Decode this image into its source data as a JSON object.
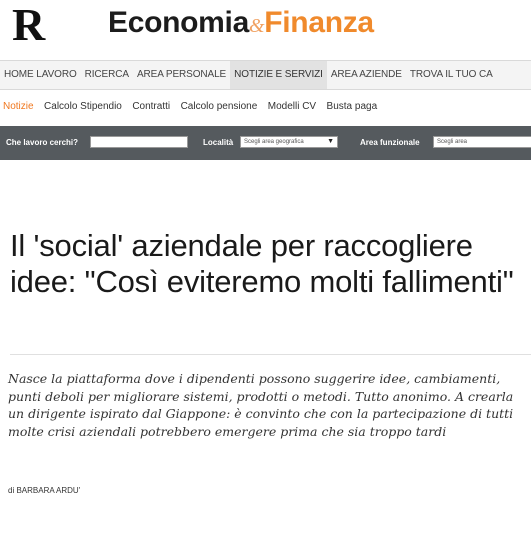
{
  "header": {
    "logo_letter": "R",
    "brand_part1": "Economia",
    "brand_amp": "&",
    "brand_part2": "Finanza"
  },
  "main_nav": {
    "items": [
      {
        "label": "HOME LAVORO"
      },
      {
        "label": "RICERCA"
      },
      {
        "label": "AREA PERSONALE"
      },
      {
        "label": "NOTIZIE E SERVIZI",
        "active": true
      },
      {
        "label": "AREA AZIENDE"
      },
      {
        "label": "TROVA IL TUO CA"
      }
    ]
  },
  "sub_nav": {
    "items": [
      {
        "label": "Notizie",
        "active": true
      },
      {
        "label": "Calcolo Stipendio"
      },
      {
        "label": "Contratti"
      },
      {
        "label": "Calcolo pensione"
      },
      {
        "label": "Modelli CV"
      },
      {
        "label": "Busta paga"
      }
    ]
  },
  "search_bar": {
    "job_label": "Che lavoro cerchi?",
    "job_value": "",
    "location_label": "Località",
    "location_select": "Scegli area geografica",
    "function_label": "Area funzionale",
    "function_select": "Scegli area"
  },
  "article": {
    "headline": "Il 'social' aziendale per raccogliere idee: \"Così eviteremo molti fallimenti\"",
    "summary": "Nasce la piattaforma dove i dipendenti possono suggerire idee, cambiamenti, punti deboli per migliorare sistemi, prodotti o metodi. Tutto anonimo. A crearla un dirigente ispirato dal Giappone: è convinto che con la partecipazione di tutti molte crisi aziendali potrebbero emergere prima che sia troppo tardi",
    "byline": "di BARBARA ARDU'"
  },
  "colors": {
    "accent_orange": "#f08a2c",
    "search_bar_bg": "#555a5e"
  }
}
